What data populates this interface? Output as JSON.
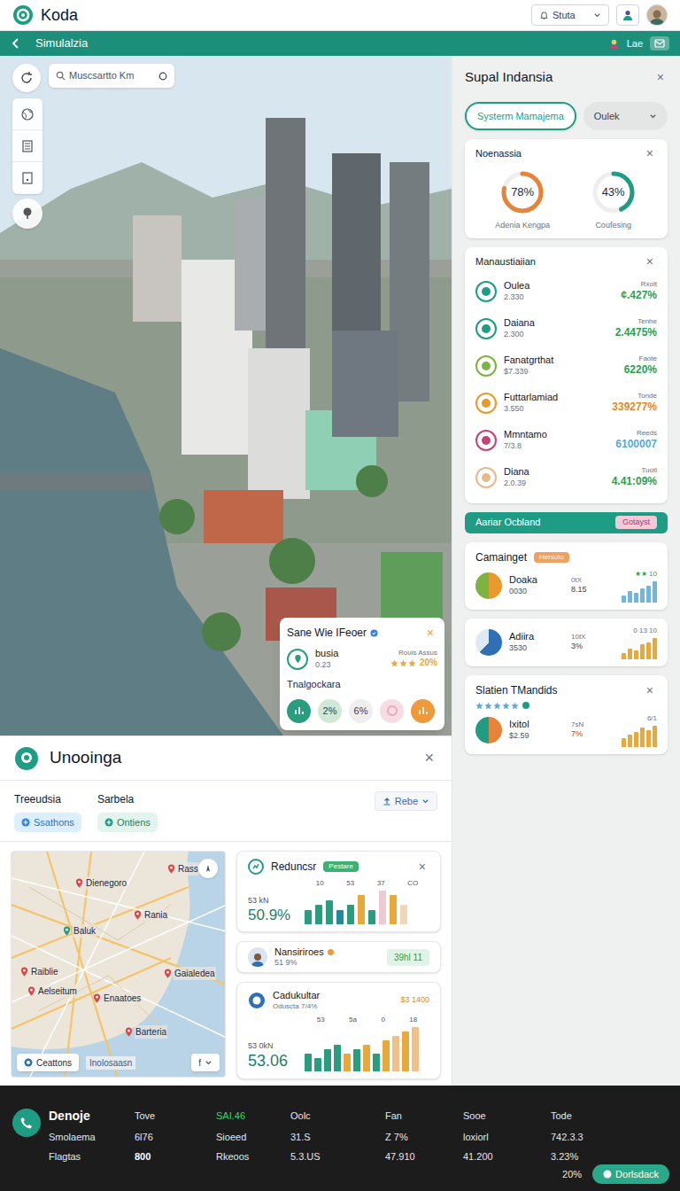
{
  "header": {
    "app_name": "Koda",
    "dropdown": "Stuta"
  },
  "nav": {
    "title": "Simulalzia",
    "user": "Lae"
  },
  "photo": {
    "search_placeholder": "Muscsartto Km",
    "popup": {
      "title": "Sane Wie IFeoer",
      "close": "×",
      "item": {
        "name": "busia",
        "sub": "0.23",
        "note": "Rouis Assus",
        "stars": 3,
        "value": "20%"
      },
      "section": "Tnalgockara",
      "chips": [
        {
          "kind": "icon",
          "color": "#2a9d7f"
        },
        {
          "kind": "text",
          "label": "2%",
          "color": "#cfe9d6"
        },
        {
          "kind": "text",
          "label": "6%",
          "color": "#eeeeee"
        },
        {
          "kind": "ring",
          "color": "#f7dde3"
        },
        {
          "kind": "icon",
          "color": "#ef9a3a"
        }
      ]
    }
  },
  "side_panel": {
    "title": "Supal Indansia",
    "close": "×",
    "tabs": [
      {
        "label": "Systerm Mamajema",
        "selected": true
      },
      {
        "label": "Oulek",
        "selected": false
      }
    ],
    "summary": {
      "title": "Noenassia",
      "close": "×",
      "rings": [
        {
          "value": "78%",
          "level": 0.78,
          "label": "Adenia Kengpa",
          "color": "#e8833a"
        },
        {
          "value": "43%",
          "level": 0.43,
          "label": "Coufesing",
          "color": "#1f9d84"
        }
      ]
    },
    "list": {
      "title": "Manaustiaiian",
      "close": "×",
      "rows": [
        {
          "name": "Oulea",
          "sub": "2.330",
          "note": "Rxolt",
          "value": "¢.427%",
          "color": "#1f9d84",
          "value_color": "#2e9e4f"
        },
        {
          "name": "Daiana",
          "sub": "2.300",
          "note": "Tenhe",
          "value": "2.4475%",
          "color": "#1f9d84",
          "value_color": "#2e9e4f"
        },
        {
          "name": "Fanatgrthat",
          "sub": "$7.339",
          "note": "Faote",
          "value": "6220%",
          "color": "#7cb342",
          "value_color": "#2e9e4f"
        },
        {
          "name": "Futtarlamiad",
          "sub": "3.550",
          "note": "Tonde",
          "value": "339277%",
          "color": "#e89a2c",
          "value_color": "#e08a1e"
        },
        {
          "name": "Mmntamo",
          "sub": "7/3.8",
          "note": "Reeds",
          "value": "6100007",
          "color": "#c2457a",
          "value_color": "#5aa9d6"
        },
        {
          "name": "Diana",
          "sub": "2.0.39",
          "note": "Tuotl",
          "value": "4.41:09%",
          "color": "#e8b98a",
          "value_color": "#2e9e4f"
        }
      ]
    },
    "section": {
      "title": "Aariar Ocbland",
      "badge": "Gotayst"
    },
    "cards": [
      {
        "title": "Camainget",
        "tag": "Hersoto",
        "corner": "★★ 10",
        "name": "Doaka",
        "value": "0030",
        "reading_top": "0tX",
        "reading_bottom": "8.15",
        "pie": {
          "share": 0.5,
          "color_a": "#e89a2c",
          "color_b": "#7cb342"
        },
        "bars": [
          3,
          5,
          4,
          6,
          7,
          9
        ],
        "bar_color": "#6fb7e0"
      },
      {
        "corner": "0 13 10",
        "name": "Adiira",
        "value": "3530",
        "reading_top": "10tX",
        "reading_bottom": "3%",
        "pie": {
          "share": 0.62,
          "color_a": "#2f6fb3",
          "color_b": "#dfe9f5"
        },
        "bars": [
          3,
          5,
          4,
          7,
          8,
          10
        ],
        "bar_color": "#e9a83a"
      },
      {
        "title": "Slatien TMandids",
        "close": "×",
        "stars": 5,
        "corner": "6/1",
        "name": "Ixitol",
        "value": "$2.59",
        "reading_top": "7sN",
        "reading_bottom": "7%",
        "pie": {
          "share": 0.5,
          "color_a": "#e8833a",
          "color_b": "#1f9d84"
        },
        "bars": [
          4,
          6,
          7,
          9,
          8,
          10
        ],
        "bar_color": "#e9a83a"
      }
    ]
  },
  "explorer": {
    "title": "Unooinga",
    "close": "×",
    "labels": [
      "Treeudsia",
      "Sarbela"
    ],
    "filters": [
      {
        "label": "Ssathons",
        "selected": true
      },
      {
        "label": "Ontiens",
        "selected": false
      }
    ],
    "action": "Rebe",
    "map": {
      "places": [
        {
          "label": "Rass",
          "color": "#d94848"
        },
        {
          "label": "Dienegoro",
          "color": "#d94848"
        },
        {
          "label": "Rania",
          "color": "#d94848"
        },
        {
          "label": "Baluk",
          "color": "#2a9d7f"
        },
        {
          "label": "Raiblie",
          "color": "#d94848"
        },
        {
          "label": "Aelseitum",
          "color": "#d94848"
        },
        {
          "label": "Enaatoes",
          "color": "#d94848"
        },
        {
          "label": "Gaialedea",
          "color": "#d94848"
        },
        {
          "label": "Barteria",
          "color": "#d94848"
        }
      ],
      "chip": "Ceattons",
      "caption": "Inolosaasn",
      "zoom_label": "f"
    },
    "chart_card": {
      "title": "Reduncsr",
      "badge": "Pestare",
      "close": "×",
      "unit": "53 kN",
      "big": "50.9%",
      "ticks": [
        "10",
        "53",
        "37",
        "CO"
      ],
      "bars": [
        3,
        4,
        5,
        3,
        4,
        6,
        3,
        7,
        6,
        4
      ],
      "bar_colors": [
        "#2a9d7f",
        "#2a9d7f",
        "#2a9d7f",
        "#1f8a9d",
        "#2a9d7f",
        "#e9a83a",
        "#2a9d7f",
        "#efc9d4",
        "#e9a83a",
        "#f0d7b8"
      ]
    },
    "person_card": {
      "name": "Nansiriroes",
      "sub": "51 9%",
      "pill": "39hl 11"
    },
    "total_card": {
      "title": "Cadukultar",
      "sub": "Oduscta 7/4%",
      "corner": "$3 1400",
      "unit": "53 0kN",
      "big": "53.06",
      "ticks": [
        "53",
        "5a",
        "0",
        "18"
      ],
      "bars": [
        4,
        3,
        5,
        6,
        4,
        5,
        6,
        4,
        7,
        8,
        9,
        10
      ],
      "bar_colors": [
        "#2a9d7f",
        "#2a9d7f",
        "#2a9d7f",
        "#2a9d7f",
        "#e9a83a",
        "#2a9d7f",
        "#e9a83a",
        "#2a9d7f",
        "#e9a83a",
        "#f0c08a",
        "#e9a83a",
        "#f0c08a"
      ]
    }
  },
  "footer": {
    "title": "Denoje",
    "columns": [
      {
        "label": "Tove",
        "highlight": false
      },
      {
        "label": "SAI.46",
        "highlight": true
      },
      {
        "label": "Oolc",
        "highlight": false
      },
      {
        "label": "Fan",
        "highlight": false
      },
      {
        "label": "Sooe",
        "highlight": false
      },
      {
        "label": "Tode",
        "highlight": false
      }
    ],
    "rows": [
      [
        "Smolaema",
        "6l76",
        "Sioeed",
        "31.S",
        "Z 7%",
        "loxiorl",
        "742.3.3"
      ],
      [
        "Flagtas",
        "800",
        "Rkeoos",
        "5.3.US",
        "47.910",
        "41.200",
        "3.23%"
      ]
    ],
    "zoom": "20%",
    "button": "Dorlsdack"
  }
}
